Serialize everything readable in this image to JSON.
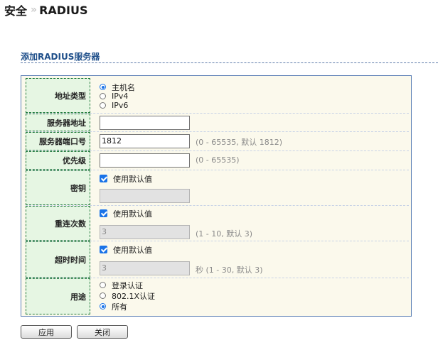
{
  "breadcrumb": {
    "parent": "安全",
    "separator": "»",
    "current": "RADIUS"
  },
  "section": {
    "title": "添加RADIUS服务器"
  },
  "form": {
    "address_type": {
      "label": "地址类型",
      "options": [
        "主机名",
        "IPv4",
        "IPv6"
      ],
      "selected": "主机名"
    },
    "server_address": {
      "label": "服务器地址",
      "value": ""
    },
    "server_port": {
      "label": "服务器端口号",
      "value": "1812",
      "hint": "(0 - 65535, 默认 1812)"
    },
    "priority": {
      "label": "优先级",
      "value": "",
      "hint": "(0 - 65535)"
    },
    "key": {
      "label": "密钥",
      "use_default_label": "使用默认值",
      "use_default": true,
      "value": ""
    },
    "retry": {
      "label": "重连次数",
      "use_default_label": "使用默认值",
      "use_default": true,
      "value": "3",
      "hint": "(1 - 10, 默认 3)"
    },
    "timeout": {
      "label": "超时时间",
      "use_default_label": "使用默认值",
      "use_default": true,
      "value": "3",
      "hint": "秒 (1 - 30, 默认 3)"
    },
    "usage": {
      "label": "用途",
      "options": [
        "登录认证",
        "802.1X认证",
        "所有"
      ],
      "selected": "所有"
    }
  },
  "buttons": {
    "apply": "应用",
    "close": "关闭"
  },
  "colors": {
    "accent": "#1a73e8",
    "label_bg": "#e6f6e3",
    "label_border": "#1f7a3a",
    "panel_bg": "#fbf9ec",
    "section_title": "#1f4f8a"
  }
}
